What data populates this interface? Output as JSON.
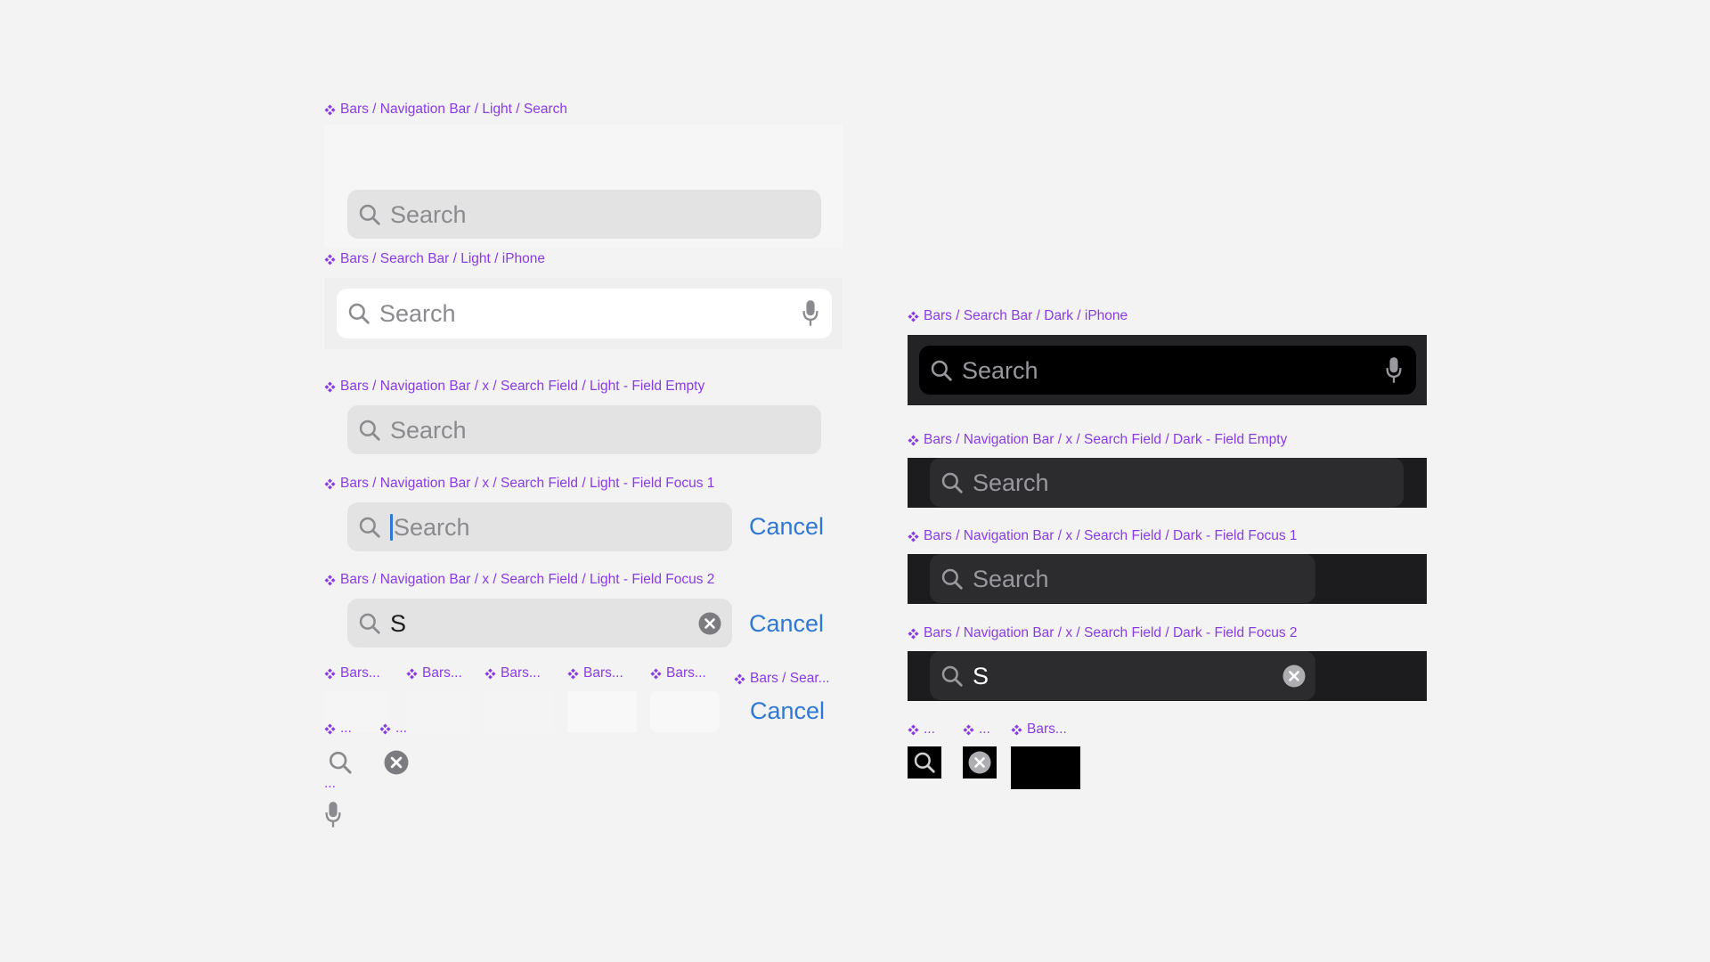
{
  "labels": {
    "nav_light_search": "Bars / Navigation Bar / Light / Search",
    "search_light_iphone": "Bars / Search Bar / Light / iPhone",
    "field_light_empty": "Bars / Navigation Bar / x / Search Field / Light - Field Empty",
    "field_light_focus1": "Bars / Navigation Bar / x / Search Field / Light - Field Focus 1",
    "field_light_focus2": "Bars / Navigation Bar / x / Search Field / Light - Field Focus 2",
    "small1": "Bars...",
    "small2": "Bars...",
    "small3": "Bars...",
    "small4": "Bars...",
    "small5": "Bars...",
    "small6": "Bars / Sear...",
    "tiny1": "...",
    "tiny2": "...",
    "tiny3": "...",
    "search_dark_iphone": "Bars / Search Bar / Dark / iPhone",
    "field_dark_empty": "Bars / Navigation Bar / x / Search Field / Dark - Field Empty",
    "field_dark_focus1": "Bars / Navigation Bar / x / Search Field / Dark - Field Focus 1",
    "field_dark_focus2": "Bars / Navigation Bar / x / Search Field / Dark - Field Focus 2",
    "dark_tiny1": "...",
    "dark_tiny2": "...",
    "dark_small": "Bars..."
  },
  "search_placeholder": "Search",
  "typed_value": "S",
  "cancel_label": "Cancel",
  "icons": {
    "component": "diamond-component-icon",
    "search": "magnifying-glass-icon",
    "mic": "microphone-icon",
    "clear": "clear-x-circle-icon"
  },
  "colors": {
    "label": "#8a3be8",
    "accent": "#2f78d6",
    "light_field": "#e3e3e4",
    "dark_field": "#2c2c2e",
    "dark_bar": "#1c1c1e"
  }
}
